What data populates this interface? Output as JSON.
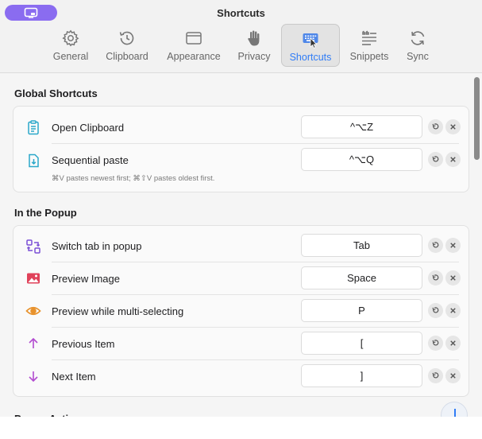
{
  "window": {
    "title": "Shortcuts"
  },
  "tabs": [
    {
      "label": "General",
      "icon": "gear-icon"
    },
    {
      "label": "Clipboard",
      "icon": "history-icon"
    },
    {
      "label": "Appearance",
      "icon": "window-icon"
    },
    {
      "label": "Privacy",
      "icon": "hand-icon"
    },
    {
      "label": "Shortcuts",
      "icon": "keyboard-icon",
      "active": true
    },
    {
      "label": "Snippets",
      "icon": "snippets-icon"
    },
    {
      "label": "Sync",
      "icon": "sync-icon"
    }
  ],
  "sections": {
    "global": {
      "title": "Global Shortcuts",
      "items": [
        {
          "label": "Open Clipboard",
          "key": "^⌥Z",
          "icon": "clipboard-icon"
        },
        {
          "label": "Sequential paste",
          "key": "^⌥Q",
          "icon": "paste-icon",
          "sub": "⌘V pastes newest first; ⌘⇧V pastes oldest first."
        }
      ]
    },
    "popup": {
      "title": "In the Popup",
      "items": [
        {
          "label": "Switch tab in popup",
          "key": "Tab",
          "icon": "switch-tab-icon"
        },
        {
          "label": "Preview Image",
          "key": "Space",
          "icon": "image-icon"
        },
        {
          "label": "Preview while multi-selecting",
          "key": "P",
          "icon": "eye-icon"
        },
        {
          "label": "Previous Item",
          "key": "[",
          "icon": "arrow-up-icon"
        },
        {
          "label": "Next Item",
          "key": "]",
          "icon": "arrow-down-icon"
        }
      ]
    },
    "next": {
      "title": "Popup Actions"
    }
  },
  "colors": {
    "accent": "#2f7cf6",
    "pill": "#8a6cf0",
    "icon_teal": "#2aa7c9",
    "icon_purple": "#7b4fd6",
    "icon_red": "#e0425a",
    "icon_orange": "#e8922c",
    "icon_magenta": "#b24bd0"
  }
}
